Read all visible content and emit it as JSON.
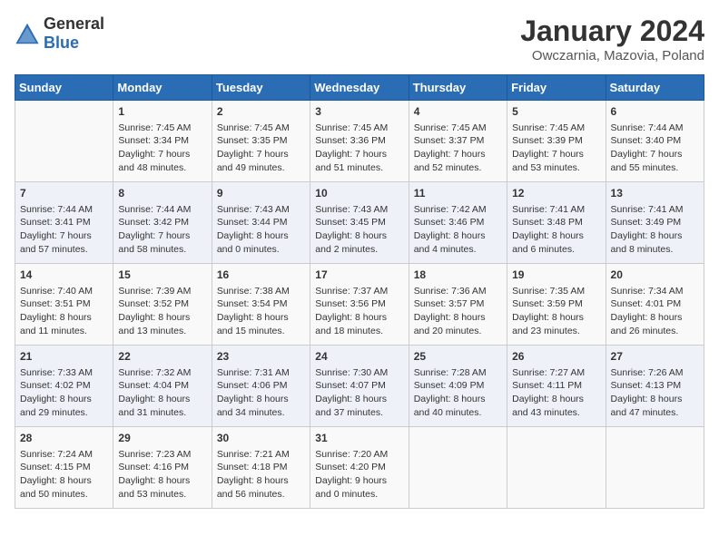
{
  "logo": {
    "general": "General",
    "blue": "Blue"
  },
  "header": {
    "month": "January 2024",
    "location": "Owczarnia, Mazovia, Poland"
  },
  "days_of_week": [
    "Sunday",
    "Monday",
    "Tuesday",
    "Wednesday",
    "Thursday",
    "Friday",
    "Saturday"
  ],
  "weeks": [
    [
      {
        "day": "",
        "content": ""
      },
      {
        "day": "1",
        "content": "Sunrise: 7:45 AM\nSunset: 3:34 PM\nDaylight: 7 hours\nand 48 minutes."
      },
      {
        "day": "2",
        "content": "Sunrise: 7:45 AM\nSunset: 3:35 PM\nDaylight: 7 hours\nand 49 minutes."
      },
      {
        "day": "3",
        "content": "Sunrise: 7:45 AM\nSunset: 3:36 PM\nDaylight: 7 hours\nand 51 minutes."
      },
      {
        "day": "4",
        "content": "Sunrise: 7:45 AM\nSunset: 3:37 PM\nDaylight: 7 hours\nand 52 minutes."
      },
      {
        "day": "5",
        "content": "Sunrise: 7:45 AM\nSunset: 3:39 PM\nDaylight: 7 hours\nand 53 minutes."
      },
      {
        "day": "6",
        "content": "Sunrise: 7:44 AM\nSunset: 3:40 PM\nDaylight: 7 hours\nand 55 minutes."
      }
    ],
    [
      {
        "day": "7",
        "content": "Sunrise: 7:44 AM\nSunset: 3:41 PM\nDaylight: 7 hours\nand 57 minutes."
      },
      {
        "day": "8",
        "content": "Sunrise: 7:44 AM\nSunset: 3:42 PM\nDaylight: 7 hours\nand 58 minutes."
      },
      {
        "day": "9",
        "content": "Sunrise: 7:43 AM\nSunset: 3:44 PM\nDaylight: 8 hours\nand 0 minutes."
      },
      {
        "day": "10",
        "content": "Sunrise: 7:43 AM\nSunset: 3:45 PM\nDaylight: 8 hours\nand 2 minutes."
      },
      {
        "day": "11",
        "content": "Sunrise: 7:42 AM\nSunset: 3:46 PM\nDaylight: 8 hours\nand 4 minutes."
      },
      {
        "day": "12",
        "content": "Sunrise: 7:41 AM\nSunset: 3:48 PM\nDaylight: 8 hours\nand 6 minutes."
      },
      {
        "day": "13",
        "content": "Sunrise: 7:41 AM\nSunset: 3:49 PM\nDaylight: 8 hours\nand 8 minutes."
      }
    ],
    [
      {
        "day": "14",
        "content": "Sunrise: 7:40 AM\nSunset: 3:51 PM\nDaylight: 8 hours\nand 11 minutes."
      },
      {
        "day": "15",
        "content": "Sunrise: 7:39 AM\nSunset: 3:52 PM\nDaylight: 8 hours\nand 13 minutes."
      },
      {
        "day": "16",
        "content": "Sunrise: 7:38 AM\nSunset: 3:54 PM\nDaylight: 8 hours\nand 15 minutes."
      },
      {
        "day": "17",
        "content": "Sunrise: 7:37 AM\nSunset: 3:56 PM\nDaylight: 8 hours\nand 18 minutes."
      },
      {
        "day": "18",
        "content": "Sunrise: 7:36 AM\nSunset: 3:57 PM\nDaylight: 8 hours\nand 20 minutes."
      },
      {
        "day": "19",
        "content": "Sunrise: 7:35 AM\nSunset: 3:59 PM\nDaylight: 8 hours\nand 23 minutes."
      },
      {
        "day": "20",
        "content": "Sunrise: 7:34 AM\nSunset: 4:01 PM\nDaylight: 8 hours\nand 26 minutes."
      }
    ],
    [
      {
        "day": "21",
        "content": "Sunrise: 7:33 AM\nSunset: 4:02 PM\nDaylight: 8 hours\nand 29 minutes."
      },
      {
        "day": "22",
        "content": "Sunrise: 7:32 AM\nSunset: 4:04 PM\nDaylight: 8 hours\nand 31 minutes."
      },
      {
        "day": "23",
        "content": "Sunrise: 7:31 AM\nSunset: 4:06 PM\nDaylight: 8 hours\nand 34 minutes."
      },
      {
        "day": "24",
        "content": "Sunrise: 7:30 AM\nSunset: 4:07 PM\nDaylight: 8 hours\nand 37 minutes."
      },
      {
        "day": "25",
        "content": "Sunrise: 7:28 AM\nSunset: 4:09 PM\nDaylight: 8 hours\nand 40 minutes."
      },
      {
        "day": "26",
        "content": "Sunrise: 7:27 AM\nSunset: 4:11 PM\nDaylight: 8 hours\nand 43 minutes."
      },
      {
        "day": "27",
        "content": "Sunrise: 7:26 AM\nSunset: 4:13 PM\nDaylight: 8 hours\nand 47 minutes."
      }
    ],
    [
      {
        "day": "28",
        "content": "Sunrise: 7:24 AM\nSunset: 4:15 PM\nDaylight: 8 hours\nand 50 minutes."
      },
      {
        "day": "29",
        "content": "Sunrise: 7:23 AM\nSunset: 4:16 PM\nDaylight: 8 hours\nand 53 minutes."
      },
      {
        "day": "30",
        "content": "Sunrise: 7:21 AM\nSunset: 4:18 PM\nDaylight: 8 hours\nand 56 minutes."
      },
      {
        "day": "31",
        "content": "Sunrise: 7:20 AM\nSunset: 4:20 PM\nDaylight: 9 hours\nand 0 minutes."
      },
      {
        "day": "",
        "content": ""
      },
      {
        "day": "",
        "content": ""
      },
      {
        "day": "",
        "content": ""
      }
    ]
  ]
}
